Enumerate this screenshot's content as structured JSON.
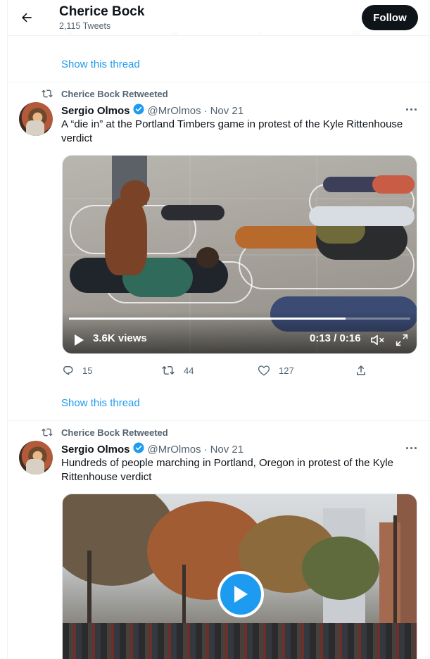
{
  "header": {
    "title": "Cherice Bock",
    "subtitle": "2,115 Tweets",
    "follow_label": "Follow"
  },
  "thread_link_1": "Show this thread",
  "tweet1": {
    "retweeted_by": "Cherice Bock Retweeted",
    "name": "Sergio Olmos",
    "handle": "@MrOlmos",
    "sep": "·",
    "date": "Nov 21",
    "text": "A “die in” at the Portland Timbers game in protest of the Kyle Rittenhouse verdict",
    "video": {
      "views": "3.6K views",
      "time": "0:13 / 0:16",
      "progress": 0.81
    },
    "replies": "15",
    "retweets": "44",
    "likes": "127"
  },
  "thread_link_2": "Show this thread",
  "tweet2": {
    "retweeted_by": "Cherice Bock Retweeted",
    "name": "Sergio Olmos",
    "handle": "@MrOlmos",
    "sep": "·",
    "date": "Nov 21",
    "text": "Hundreds of people marching in Portland, Oregon in protest of the Kyle Rittenhouse verdict"
  },
  "colors": {
    "accent": "#1d9bf0",
    "text": "#0f1419",
    "secondary": "#536471"
  }
}
